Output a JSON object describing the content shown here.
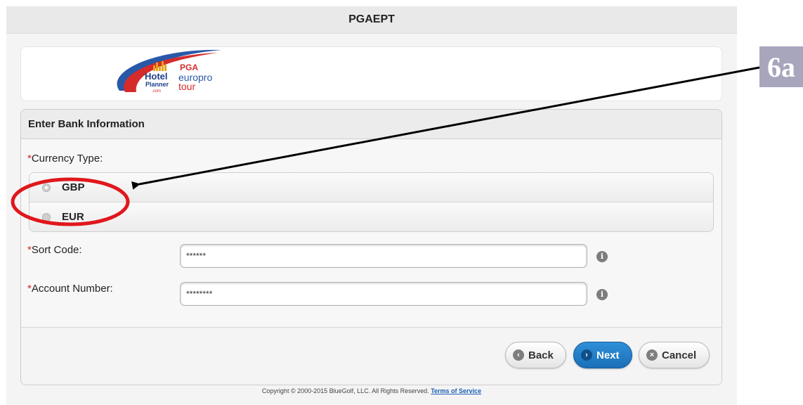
{
  "header": {
    "title": "PGAEPT"
  },
  "logo": {
    "hotel_line1": "Hotel",
    "hotel_line2": "Planner",
    "hotel_line3": ".com",
    "brand_top": "PGA",
    "brand_mid": "europro",
    "brand_bottom": "tour",
    "colors": {
      "blue": "#2a58a8",
      "red": "#d62b2b"
    }
  },
  "form": {
    "title": "Enter Bank Information",
    "required_marker": "*",
    "currency": {
      "label": "Currency Type:",
      "options": [
        "GBP",
        "EUR"
      ],
      "selected": "GBP"
    },
    "sort_code": {
      "label": "Sort Code:",
      "value": "******"
    },
    "account_number": {
      "label": "Account Number:",
      "value": "********"
    },
    "info_glyph": "i"
  },
  "buttons": {
    "back": "Back",
    "next": "Next",
    "cancel": "Cancel"
  },
  "footer": {
    "copyright": "Copyright © 2000-2015 BlueGolf, LLC. All Rights Reserved.",
    "terms_link": "Terms of Service"
  },
  "annotation": {
    "label": "6a",
    "label_bg": "#a8a6bd",
    "circle_color": "#e0171c",
    "arrow_color": "#000000"
  },
  "colors": {
    "primary_button": "#1f78c8",
    "required": "#dd2222",
    "link": "#1a5fb4"
  }
}
